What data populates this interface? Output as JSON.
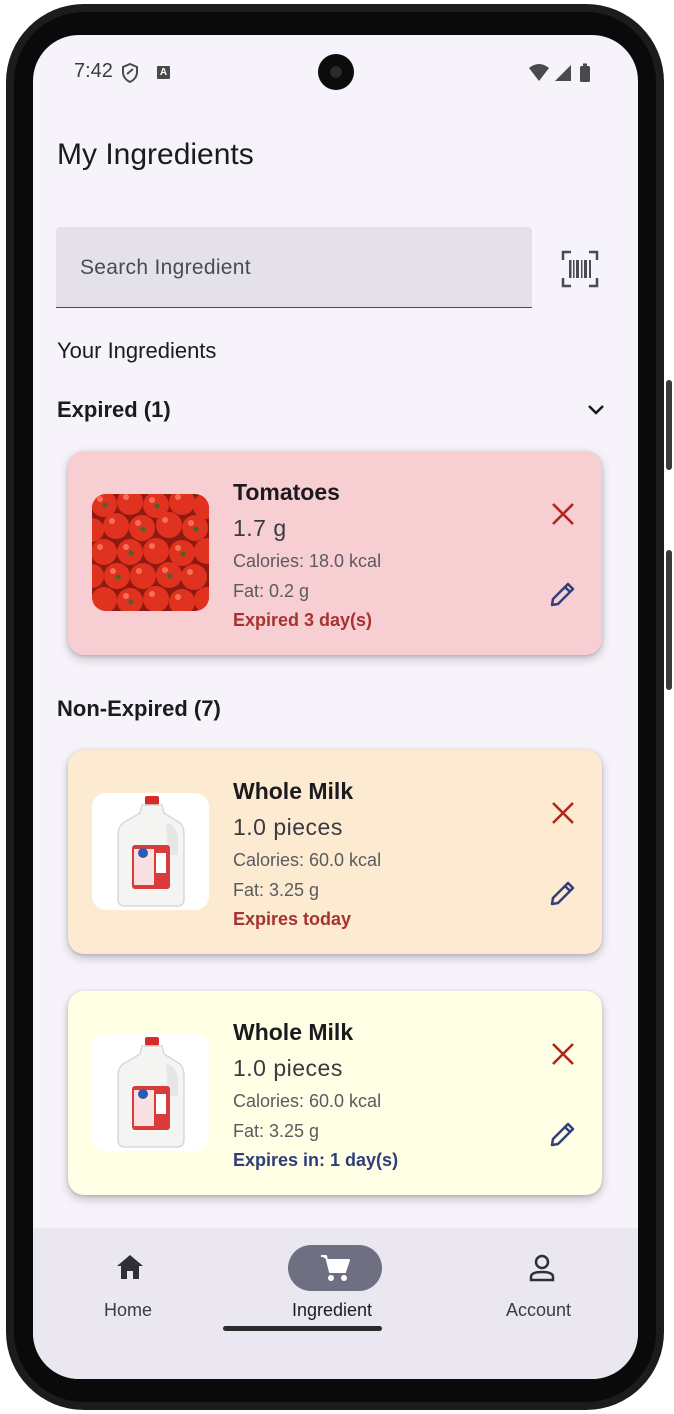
{
  "status_bar": {
    "time": "7:42",
    "a_icon": "A"
  },
  "header": {
    "title": "My Ingredients"
  },
  "search": {
    "placeholder": "Search Ingredient"
  },
  "sections": {
    "your_ingredients": "Your Ingredients",
    "expired_label": "Expired (1)",
    "non_expired_label": "Non-Expired (7)"
  },
  "cards": [
    {
      "name": "Tomatoes",
      "quantity": "1.7 g",
      "calories": "Calories: 18.0 kcal",
      "fat": "Fat: 0.2 g",
      "status": "Expired 3 day(s)",
      "bg": "#f7cfd3",
      "status_color": "#a83232",
      "image": "tomatoes"
    },
    {
      "name": "Whole Milk",
      "quantity": "1.0 pieces",
      "calories": "Calories: 60.0 kcal",
      "fat": "Fat: 3.25 g",
      "status": "Expires today",
      "bg": "#fcebd0",
      "status_color": "#a83232",
      "image": "milk-jug"
    },
    {
      "name": "Whole Milk",
      "quantity": "1.0 pieces",
      "calories": "Calories: 60.0 kcal",
      "fat": "Fat: 3.25 g",
      "status": "Expires in: 1 day(s)",
      "bg": "#feffe4",
      "status_color": "#2f3d7a",
      "image": "milk-jug"
    }
  ],
  "bottom_nav": {
    "items": [
      {
        "label": "Home",
        "icon": "home-icon"
      },
      {
        "label": "Ingredient",
        "icon": "cart-icon",
        "active": true
      },
      {
        "label": "Account",
        "icon": "person-icon"
      }
    ]
  },
  "colors": {
    "delete": "#b3261e",
    "edit": "#33407a",
    "active_pill": "#6e7081"
  }
}
